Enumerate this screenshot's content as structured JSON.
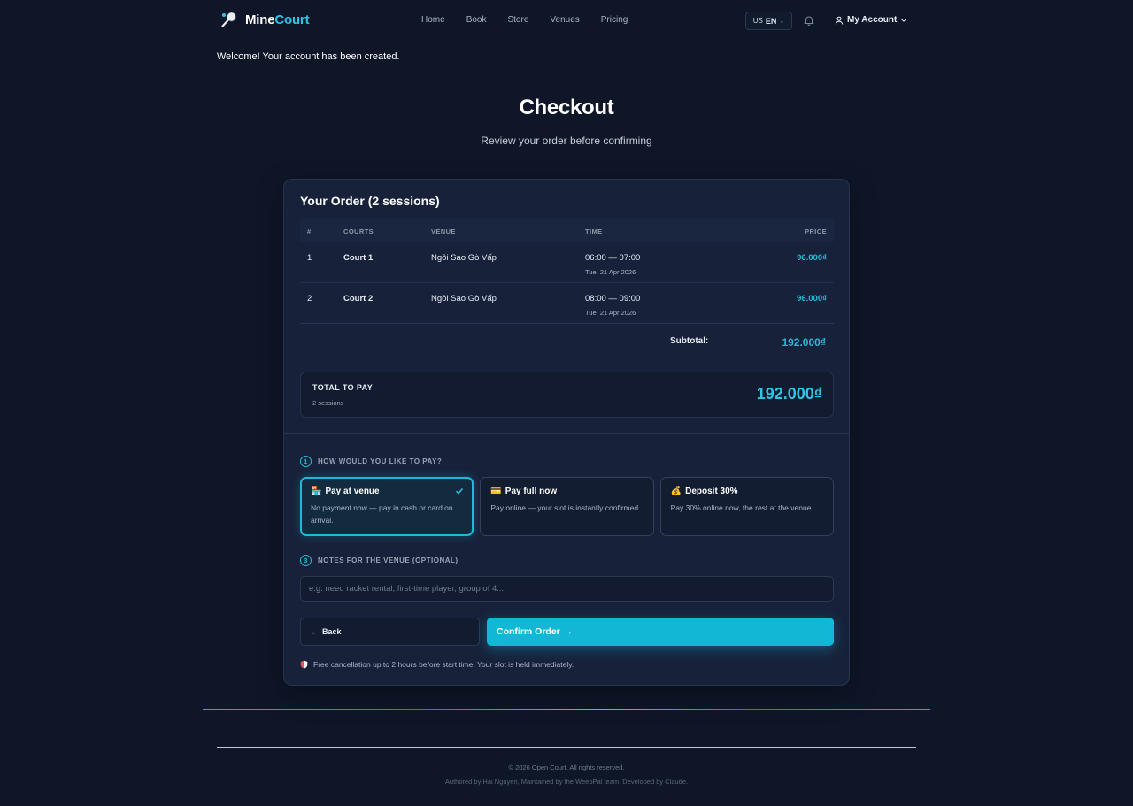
{
  "brand": {
    "name_part1": "Mine",
    "name_part2": "Court"
  },
  "nav": {
    "items": [
      "Home",
      "Book",
      "Store",
      "Venues",
      "Pricing"
    ]
  },
  "lang": {
    "flag": "US",
    "code": "EN"
  },
  "account": {
    "label": "My Account"
  },
  "welcome": "Welcome! Your account has been created.",
  "page": {
    "title": "Checkout",
    "subtitle": "Review your order before confirming"
  },
  "order": {
    "title": "Your Order (2 sessions)",
    "columns": [
      "#",
      "COURTS",
      "VENUE",
      "TIME",
      "PRICE"
    ],
    "rows": [
      {
        "num": "1",
        "court": "Court 1",
        "venue": "Ngôi Sao Gò Vấp",
        "time": "06:00 — 07:00",
        "date": "Tue, 21 Apr 2026",
        "price": "96.000₫"
      },
      {
        "num": "2",
        "court": "Court 2",
        "venue": "Ngôi Sao Gò Vấp",
        "time": "08:00 — 09:00",
        "date": "Tue, 21 Apr 2026",
        "price": "96.000₫"
      }
    ],
    "subtotal_label": "Subtotal:",
    "subtotal": "192.000₫"
  },
  "total": {
    "label": "TOTAL TO PAY",
    "sub": "2 sessions",
    "value": "192.000₫"
  },
  "payment": {
    "step": "1",
    "heading": "HOW WOULD YOU LIKE TO PAY?",
    "options": [
      {
        "icon": "🏪",
        "title": "Pay at venue",
        "desc": "No payment now — pay in cash or card on arrival.",
        "selected": true
      },
      {
        "icon": "💳",
        "title": "Pay full now",
        "desc": "Pay online — your slot is instantly confirmed.",
        "selected": false
      },
      {
        "icon": "💰",
        "title": "Deposit 30%",
        "desc": "Pay 30% online now, the rest at the venue.",
        "selected": false
      }
    ]
  },
  "notes": {
    "step": "3",
    "heading": "NOTES FOR THE VENUE (OPTIONAL)",
    "placeholder": "e.g. need racket rental, first-time player, group of 4..."
  },
  "buttons": {
    "back": "Back",
    "confirm": "Confirm Order"
  },
  "cancellation": "Free cancellation up to 2 hours before start time. Your slot is held immediately.",
  "footer": {
    "copyright": "© 2026 Open Court. All rights reserved.",
    "credit": "Authored by Hai Nguyen, Maintained by the WeebPal team, Developed by Claude."
  },
  "colors": {
    "accent": "#12b7d6",
    "background": "#0e1628",
    "card": "#17223a"
  }
}
